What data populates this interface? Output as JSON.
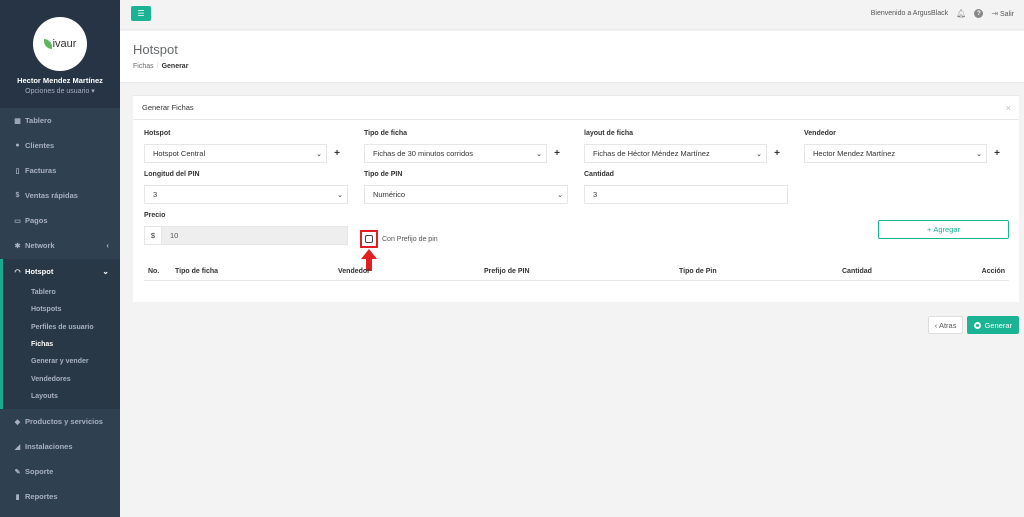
{
  "brand": {
    "logo_text": "ivaur"
  },
  "user": {
    "name": "Hector Mendez Martínez",
    "options": "Opciones de usuario ▾"
  },
  "nav": {
    "items_top": [
      {
        "label": "Tablero",
        "icon": "dashboard-icon"
      },
      {
        "label": "Clientes",
        "icon": "users-icon"
      },
      {
        "label": "Facturas",
        "icon": "file-icon"
      },
      {
        "label": "Ventas rápidas",
        "icon": "dollar-icon"
      },
      {
        "label": "Pagos",
        "icon": "money-icon"
      },
      {
        "label": "Network",
        "icon": "network-icon"
      }
    ],
    "active": {
      "label": "Hotspot",
      "icon": "wifi-icon"
    },
    "sub_items": [
      "Tablero",
      "Hotspots",
      "Perfiles de usuario",
      "Fichas",
      "Generar y vender",
      "Vendedores",
      "Layouts"
    ],
    "items_bottom": [
      {
        "label": "Productos y servicios",
        "icon": "tags-icon"
      },
      {
        "label": "Instalaciones",
        "icon": "wrench-icon"
      },
      {
        "label": "Soporte",
        "icon": "tool-icon"
      },
      {
        "label": "Reportes",
        "icon": "book-icon"
      }
    ]
  },
  "topbar": {
    "welcome": "Bienvenido a ArgusBlack",
    "logout": "Salir"
  },
  "page": {
    "title": "Hotspot",
    "breadcrumb": [
      "Fichas",
      "Generar"
    ]
  },
  "panel": {
    "title": "Generar Fichas",
    "fields": {
      "hotspot": {
        "label": "Hotspot",
        "value": "Hotspot Central"
      },
      "tipo_ficha": {
        "label": "Tipo de ficha",
        "value": "Fichas de 30 minutos corridos"
      },
      "layout": {
        "label": "layout de ficha",
        "value": "Fichas de Héctor Méndez Martínez"
      },
      "vendedor": {
        "label": "Vendedor",
        "value": "Hector Mendez Martínez"
      },
      "longitud_pin": {
        "label": "Longitud del PIN",
        "value": "3"
      },
      "tipo_pin": {
        "label": "Tipo de PIN",
        "value": "Numérico"
      },
      "cantidad": {
        "label": "Cantidad",
        "value": "3"
      },
      "precio": {
        "label": "Precio",
        "currency": "$",
        "value": "10"
      }
    },
    "prefix_label": "Con Prefijo de pin",
    "add_label": "Agregar",
    "table_headers": [
      "No.",
      "Tipo de ficha",
      "Vendedor",
      "Prefijo de PIN",
      "Tipo de Pin",
      "Cantidad",
      "Acción"
    ]
  },
  "actions": {
    "back": "‹ Atras",
    "generate": "Generar"
  },
  "colors": {
    "accent": "#1ab394",
    "sidebar": "#2f4050",
    "highlight": "#e02020"
  }
}
